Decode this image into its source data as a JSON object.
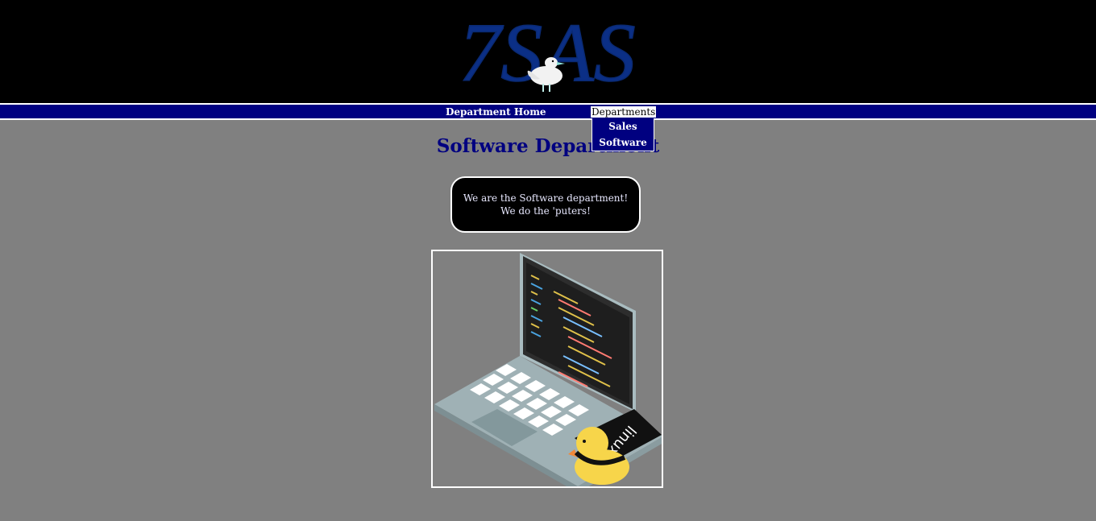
{
  "header": {
    "logo_text": "7SAS",
    "logo_icon": "duck-icon",
    "colors": {
      "background": "#000000",
      "logo": "#0b2f86"
    }
  },
  "nav": {
    "home_label": "Department Home",
    "departments_label": "Departments",
    "dropdown_items": [
      {
        "label": "Sales"
      },
      {
        "label": "Software"
      }
    ],
    "colors": {
      "bar": "#000080",
      "text": "#ffffff"
    }
  },
  "main": {
    "title": "Software Department",
    "intro": {
      "line1": "We are the Software department!",
      "line2": "We do the 'puters!"
    },
    "illustration": {
      "icon": "laptop-with-duck-icon",
      "sticker_text": "linux"
    }
  },
  "colors": {
    "page_background": "#808080",
    "title": "#000080"
  }
}
